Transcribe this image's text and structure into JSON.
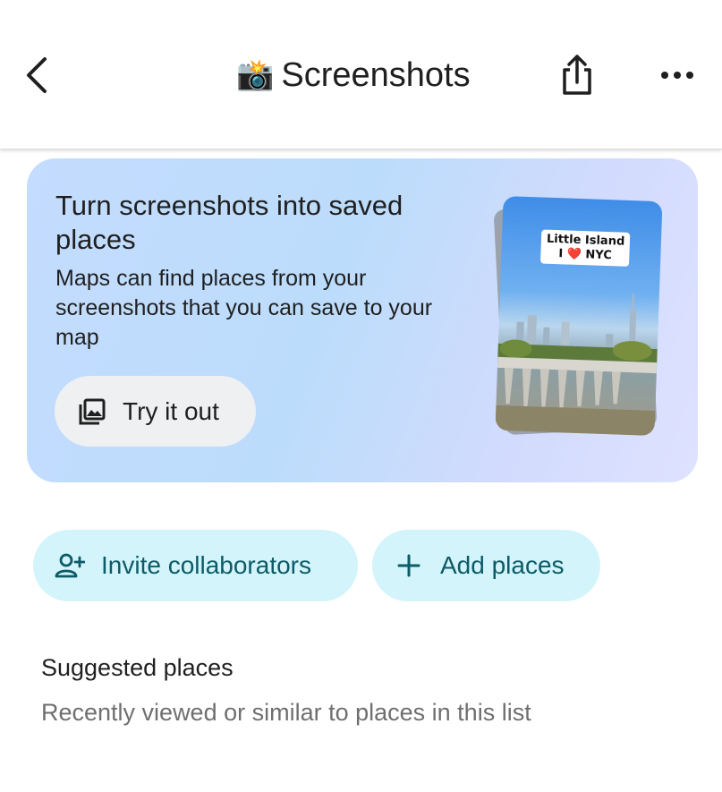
{
  "header": {
    "title_emoji": "📸",
    "title": "Screenshots",
    "back_icon": "chevron-left-icon",
    "share_icon": "share-icon",
    "more_icon": "more-horizontal-icon"
  },
  "promo": {
    "title": "Turn screenshots into saved places",
    "body": "Maps can find places from your screenshots that you can save to your map",
    "button_label": "Try it out",
    "button_icon": "photo-library-icon",
    "sticker_line1": "Little Island",
    "sticker_line2": "I ❤️ NYC"
  },
  "actions": {
    "invite_label": "Invite collaborators",
    "invite_icon": "person-add-icon",
    "add_label": "Add places",
    "add_icon": "plus-icon"
  },
  "suggested": {
    "title": "Suggested places",
    "subtitle": "Recently viewed or similar to places in this list"
  },
  "colors": {
    "chip_bg": "#d3f4fb",
    "chip_text": "#0c5b66",
    "button_bg": "#eff0f2"
  }
}
